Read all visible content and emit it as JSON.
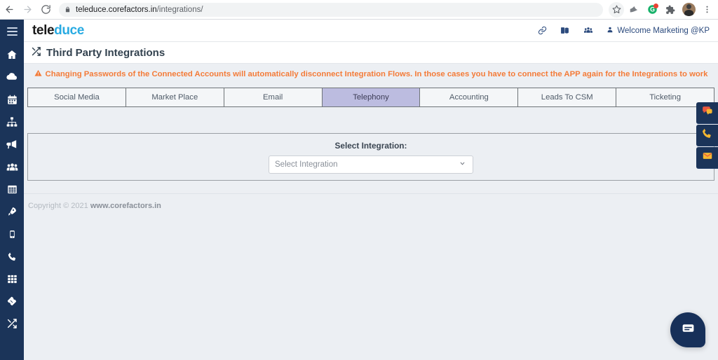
{
  "browser": {
    "back_icon": "back-arrow-icon",
    "forward_icon": "forward-arrow-icon",
    "reload_icon": "reload-icon",
    "lock_icon": "lock-icon",
    "url_host": "teleduce.corefactors.in",
    "url_path": "/integrations/",
    "star_icon": "bookmark-star-icon",
    "icons": [
      "shield-icon",
      "g-suite-icon",
      "extensions-puzzle-icon",
      "profile-avatar",
      "chrome-menu-icon"
    ]
  },
  "sidebar": {
    "toggle_label": "menu-toggle",
    "items": [
      {
        "name": "home",
        "label": "Home"
      },
      {
        "name": "cloud",
        "label": "Cloud"
      },
      {
        "name": "calendar",
        "label": "Calendar"
      },
      {
        "name": "sitemap",
        "label": "Sitemap"
      },
      {
        "name": "bullhorn",
        "label": "Campaigns"
      },
      {
        "name": "users",
        "label": "Teams"
      },
      {
        "name": "table",
        "label": "Reports"
      },
      {
        "name": "rocket",
        "label": "Launch"
      },
      {
        "name": "mobile",
        "label": "Mobile"
      },
      {
        "name": "phone",
        "label": "Calls"
      },
      {
        "name": "keypad",
        "label": "Dialer"
      },
      {
        "name": "ticket",
        "label": "Tickets"
      },
      {
        "name": "shuffle",
        "label": "Integrations"
      }
    ]
  },
  "header": {
    "brand_dark": "tele",
    "brand_blue": "duce",
    "icons": [
      "link-icon",
      "server-icon",
      "users-icon"
    ],
    "welcome_text": "Welcome Marketing @KP",
    "welcome_user_icon": "user-icon"
  },
  "title_bar": {
    "icon": "shuffle-icon",
    "title": "Third Party Integrations"
  },
  "warning": {
    "icon": "warning-triangle-icon",
    "text": "Changing Passwords of the Connected Accounts will automatically disconnect Integration Flows. In those cases you have to connect the APP again for the Integrations to work",
    "color": "#f47b38"
  },
  "tabs": [
    {
      "label": "Social Media",
      "active": false
    },
    {
      "label": "Market Place",
      "active": false
    },
    {
      "label": "Email",
      "active": false
    },
    {
      "label": "Telephony",
      "active": true
    },
    {
      "label": "Accounting",
      "active": false
    },
    {
      "label": "Leads To CSM",
      "active": false
    },
    {
      "label": "Ticketing",
      "active": false
    }
  ],
  "integration_panel": {
    "label": "Select Integration:",
    "select_value": "Select Integration",
    "select_placeholder": "Select Integration",
    "options": [
      "Select Integration"
    ],
    "caret_icon": "chevron-down-icon"
  },
  "footer": {
    "copyright": "Copyright © 2021",
    "link": "www.corefactors.in"
  },
  "float_buttons": [
    {
      "name": "chat-bubble",
      "label": "Chat"
    },
    {
      "name": "phone",
      "label": "Call"
    },
    {
      "name": "envelope",
      "label": "Email"
    }
  ],
  "chat_widget": {
    "icon": "message-icon",
    "label": "Open chat",
    "color": "#173059"
  }
}
